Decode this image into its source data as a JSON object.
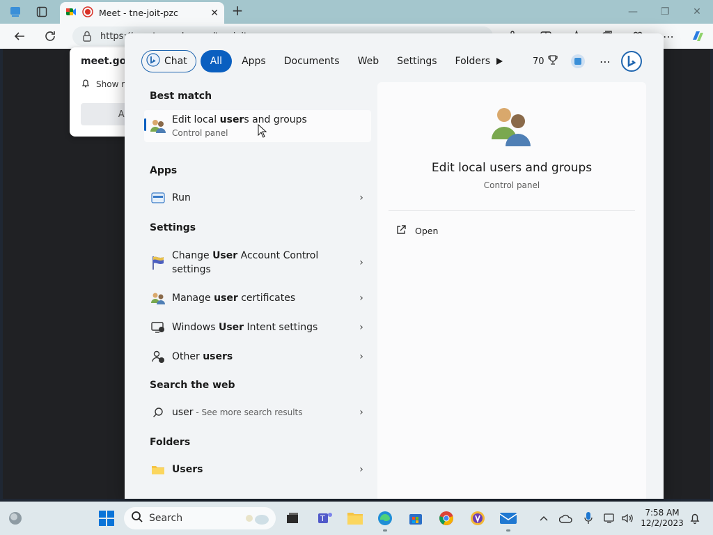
{
  "browser": {
    "tab_title": "Meet - tne-joit-pzc",
    "address_text": "https://meet.google.com/tne-joit-pzc"
  },
  "popup": {
    "site": "meet.goog",
    "line": "Show n",
    "button": "Al"
  },
  "search": {
    "filters": {
      "chat": "Chat",
      "all": "All",
      "apps": "Apps",
      "documents": "Documents",
      "web": "Web",
      "settings": "Settings",
      "folders": "Folders",
      "points": "70"
    },
    "sections": {
      "best_match": "Best match",
      "apps": "Apps",
      "settings": "Settings",
      "web": "Search the web",
      "folders": "Folders"
    },
    "best": {
      "pre": "Edit local ",
      "bold": "user",
      "post": "s and groups",
      "sub": "Control panel"
    },
    "apps_run": "Run",
    "settings_items": {
      "uac_pre": "Change ",
      "uac_bold": "User",
      "uac_post": " Account Control settings",
      "cert_pre": "Manage ",
      "cert_bold": "user",
      "cert_post": " certificates",
      "intent_pre": "Windows ",
      "intent_bold": "User",
      "intent_post": " Intent settings",
      "other_pre": "Other ",
      "other_bold": "users"
    },
    "web_query": "user",
    "web_suffix": " - See more search results",
    "folder_users": "Users"
  },
  "preview": {
    "title": "Edit local users and groups",
    "subtitle": "Control panel",
    "action_open": "Open"
  },
  "taskbar": {
    "search_label": "Search",
    "time": "7:58 AM",
    "date": "12/2/2023"
  },
  "colors": {
    "accent": "#0a5fc0",
    "tabbar": "#a4c6cd"
  }
}
